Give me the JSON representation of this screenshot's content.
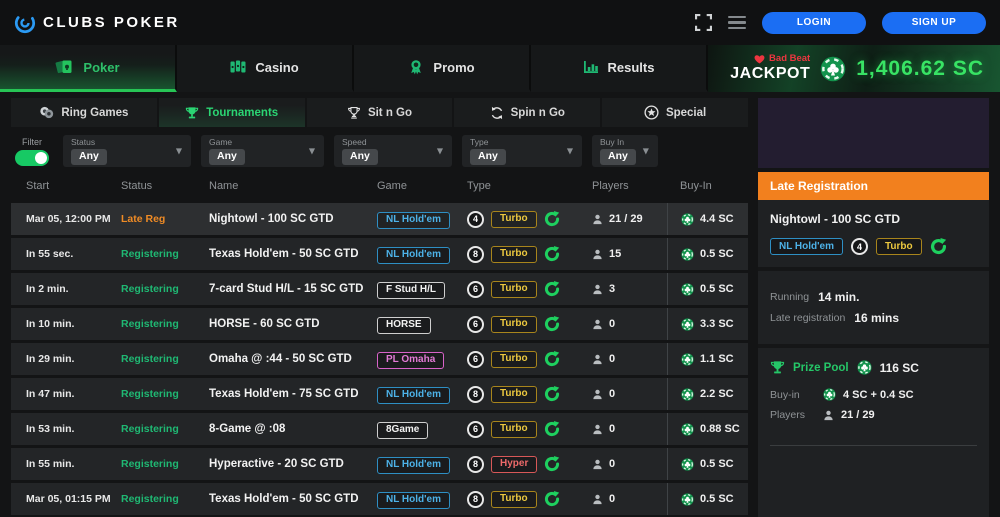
{
  "header": {
    "logo": "CLUBS POKER",
    "login": "LOGIN",
    "signup": "SIGN UP"
  },
  "nav": {
    "tabs": [
      {
        "label": "Poker",
        "active": true
      },
      {
        "label": "Casino"
      },
      {
        "label": "Promo"
      },
      {
        "label": "Results"
      }
    ],
    "jackpot": {
      "badge": "Bad Beat",
      "label": "JACKPOT",
      "value": "1,406.62 SC"
    }
  },
  "subnav": {
    "tabs": [
      {
        "label": "Ring Games"
      },
      {
        "label": "Tournaments",
        "active": true
      },
      {
        "label": "Sit n Go"
      },
      {
        "label": "Spin n Go"
      },
      {
        "label": "Special"
      }
    ]
  },
  "filters": {
    "toggle_label": "Filter",
    "toggle_on": true,
    "dropdowns": [
      {
        "label": "Status",
        "value": "Any"
      },
      {
        "label": "Game",
        "value": "Any"
      },
      {
        "label": "Speed",
        "value": "Any"
      },
      {
        "label": "Type",
        "value": "Any"
      },
      {
        "label": "Buy In",
        "value": "Any"
      }
    ]
  },
  "table": {
    "columns": [
      "Start",
      "Status",
      "Name",
      "Game",
      "Type",
      "Players",
      "Buy-In"
    ],
    "rows": [
      {
        "start": "Mar 05, 12:00 PM",
        "status": "Late Reg",
        "status_type": "late",
        "name": "Nightowl - 100 SC GTD",
        "game": "NL Hold'em",
        "game_color": "blue",
        "seats": "4",
        "speed": "Turbo",
        "speed_color": "gold",
        "players": "21 / 29",
        "buyin": "4.4 SC",
        "selected": true
      },
      {
        "start": "In 55 sec.",
        "status": "Registering",
        "status_type": "reg",
        "name": "Texas Hold'em - 50 SC GTD",
        "game": "NL Hold'em",
        "game_color": "blue",
        "seats": "8",
        "speed": "Turbo",
        "speed_color": "gold",
        "players": "15",
        "buyin": "0.5 SC"
      },
      {
        "start": "In 2 min.",
        "status": "Registering",
        "status_type": "reg",
        "name": "7-card Stud H/L - 15 SC GTD",
        "game": "F Stud H/L",
        "game_color": "white",
        "seats": "6",
        "speed": "Turbo",
        "speed_color": "gold",
        "players": "3",
        "buyin": "0.5 SC"
      },
      {
        "start": "In 10 min.",
        "status": "Registering",
        "status_type": "reg",
        "name": "HORSE - 60 SC GTD",
        "game": "HORSE",
        "game_color": "white",
        "seats": "6",
        "speed": "Turbo",
        "speed_color": "gold",
        "players": "0",
        "buyin": "3.3 SC"
      },
      {
        "start": "In 29 min.",
        "status": "Registering",
        "status_type": "reg",
        "name": "Omaha @ :44 - 50 SC GTD",
        "game": "PL Omaha",
        "game_color": "pink",
        "seats": "6",
        "speed": "Turbo",
        "speed_color": "gold",
        "players": "0",
        "buyin": "1.1 SC"
      },
      {
        "start": "In 47 min.",
        "status": "Registering",
        "status_type": "reg",
        "name": "Texas Hold'em - 75 SC GTD",
        "game": "NL Hold'em",
        "game_color": "blue",
        "seats": "8",
        "speed": "Turbo",
        "speed_color": "gold",
        "players": "0",
        "buyin": "2.2 SC"
      },
      {
        "start": "In 53 min.",
        "status": "Registering",
        "status_type": "reg",
        "name": "8-Game @ :08",
        "game": "8Game",
        "game_color": "white",
        "seats": "6",
        "speed": "Turbo",
        "speed_color": "gold",
        "players": "0",
        "buyin": "0.88 SC"
      },
      {
        "start": "In 55 min.",
        "status": "Registering",
        "status_type": "reg",
        "name": "Hyperactive - 20 SC GTD",
        "game": "NL Hold'em",
        "game_color": "blue",
        "seats": "8",
        "speed": "Hyper",
        "speed_color": "red",
        "players": "0",
        "buyin": "0.5 SC"
      },
      {
        "start": "Mar 05, 01:15 PM",
        "status": "Registering",
        "status_type": "reg",
        "name": "Texas Hold'em - 50 SC GTD",
        "game": "NL Hold'em",
        "game_color": "blue",
        "seats": "8",
        "speed": "Turbo",
        "speed_color": "gold",
        "players": "0",
        "buyin": "0.5 SC"
      }
    ]
  },
  "sidebar": {
    "header": "Late Registration",
    "title": "Nightowl - 100 SC GTD",
    "game_badge": "NL Hold'em",
    "seats_badge": "4",
    "speed_badge": "Turbo",
    "running_label": "Running",
    "running_value": "14 min.",
    "late_reg_label": "Late registration",
    "late_reg_value": "16 mins",
    "prize_pool_label": "Prize Pool",
    "prize_pool_value": "116 SC",
    "buyin_label": "Buy-in",
    "buyin_value": "4 SC + 0.4 SC",
    "players_label": "Players",
    "players_value": "21 / 29"
  },
  "colors": {
    "accent_green": "#1fb873",
    "jackpot_green": "#38e364",
    "header_orange": "#f2801e",
    "button_blue": "#1b6ef3",
    "status_late_orange": "#ef8b25",
    "badge_blue": "#4db2e8",
    "badge_pink": "#e37ad6",
    "badge_gold": "#ecc83f",
    "badge_red": "#ee6a6a"
  }
}
